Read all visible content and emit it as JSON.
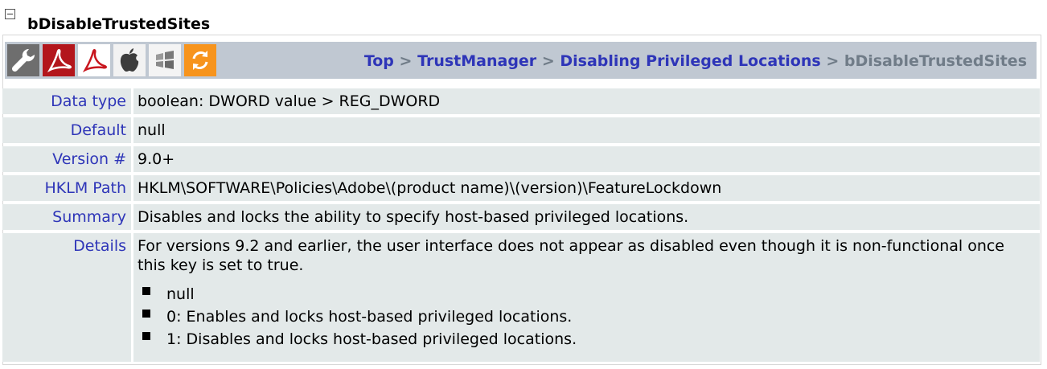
{
  "heading": {
    "title": "bDisableTrustedSites"
  },
  "toolbar": {
    "icons": [
      "wrench-icon",
      "acrobat-icon",
      "reader-icon",
      "apple-icon",
      "windows-icon",
      "sync-icon"
    ],
    "breadcrumb": {
      "top": "Top",
      "sep1": ">",
      "trust_manager": "TrustManager",
      "sep2": ">",
      "disabling": "Disabling Privileged Locations",
      "sep3": ">",
      "current": "bDisableTrustedSites"
    }
  },
  "properties": {
    "data_type": {
      "label": "Data type",
      "value": "boolean: DWORD value > REG_DWORD"
    },
    "default": {
      "label": "Default",
      "value": "null"
    },
    "version": {
      "label": "Version #",
      "value": "9.0+"
    },
    "hklm_path": {
      "label": "HKLM Path",
      "value": "HKLM\\SOFTWARE\\Policies\\Adobe\\(product name)\\(version)\\FeatureLockdown"
    },
    "summary": {
      "label": "Summary",
      "value": "Disables and locks the ability to specify host-based privileged locations."
    },
    "details": {
      "label": "Details",
      "text": "For versions 9.2 and earlier, the user interface does not appear as disabled even though it is non-functional once this key is set to true.",
      "options": [
        "null",
        "0: Enables and locks host-based privileged locations.",
        "1: Disables and locks host-based privileged locations."
      ]
    }
  },
  "colors": {
    "link": "#2e35b8",
    "toolbar_bg": "#c0c8d2",
    "row_bg": "#e3e9e9",
    "current_crumb": "#707c88"
  }
}
